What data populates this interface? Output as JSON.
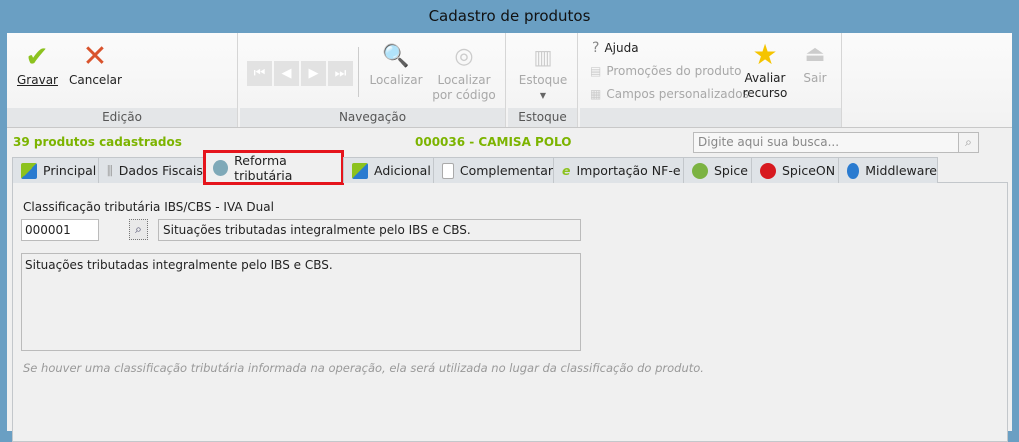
{
  "window": {
    "title": "Cadastro de produtos"
  },
  "ribbon": {
    "edicao": {
      "label": "Edição",
      "gravar": "Gravar",
      "cancelar": "Cancelar"
    },
    "navegacao": {
      "label": "Navegação",
      "localizar": "Localizar",
      "localizar_codigo_1": "Localizar",
      "localizar_codigo_2": "por código"
    },
    "estoque": {
      "label": "Estoque",
      "button": "Estoque"
    },
    "outros": {
      "ajuda": "Ajuda",
      "promocoes": "Promoções do produto",
      "campos": "Campos personalizados",
      "avaliar_1": "Avaliar",
      "avaliar_2": "recurso",
      "sair": "Sair"
    }
  },
  "status": {
    "count": "39 produtos cadastrados",
    "product": "000036 - CAMISA POLO",
    "search_placeholder": "Digite aqui sua busca..."
  },
  "tabs": [
    {
      "label": "Principal"
    },
    {
      "label": "Dados Fiscais"
    },
    {
      "label": "Reforma tributária"
    },
    {
      "label": "Adicional"
    },
    {
      "label": "Complementar"
    },
    {
      "label": "Importação NF-e"
    },
    {
      "label": "Spice"
    },
    {
      "label": "SpiceON"
    },
    {
      "label": "Middleware"
    }
  ],
  "form": {
    "label": "Classificação tributária IBS/CBS - IVA Dual",
    "code": "000001",
    "description": "Situações tributadas integralmente pelo IBS e CBS.",
    "details": "Situações tributadas integralmente pelo IBS e CBS.",
    "hint": "Se houver uma classificação tributária informada na operação, ela será utilizada no lugar da classificação do produto."
  },
  "colors": {
    "accent_green": "#7cb400",
    "highlight": "#e5141c",
    "titlebar": "#6a9fc3"
  }
}
